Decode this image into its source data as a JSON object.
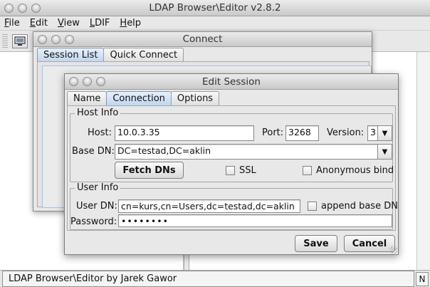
{
  "main_window": {
    "title": "LDAP Browser\\Editor v2.8.2",
    "menu": [
      "File",
      "Edit",
      "View",
      "LDIF",
      "Help"
    ],
    "status_text": "LDAP Browser\\Editor by Jarek Gawor",
    "status_mode": "N"
  },
  "connect_dialog": {
    "title": "Connect",
    "tabs": [
      "Session List",
      "Quick Connect"
    ],
    "active_tab": "Session List"
  },
  "edit_session": {
    "title": "Edit Session",
    "tabs": [
      "Name",
      "Connection",
      "Options"
    ],
    "active_tab": "Connection",
    "host_info": {
      "label": "Host Info",
      "host_label": "Host:",
      "host_value": "10.0.3.35",
      "port_label": "Port:",
      "port_value": "3268",
      "version_label": "Version:",
      "version_value": "3",
      "base_dn_label": "Base DN:",
      "base_dn_value": "DC=testad,DC=aklin",
      "fetch_button": "Fetch DNs",
      "ssl_label": "SSL",
      "ssl_checked": false,
      "anon_label": "Anonymous bind",
      "anon_checked": false
    },
    "user_info": {
      "label": "User Info",
      "user_dn_label": "User DN:",
      "user_dn_value": "cn=kurs,cn=Users,dc=testad,dc=aklin",
      "append_label": "append base DN",
      "append_checked": false,
      "password_label": "Password:",
      "password_value": "••••••••"
    },
    "save_button": "Save",
    "cancel_button": "Cancel"
  }
}
